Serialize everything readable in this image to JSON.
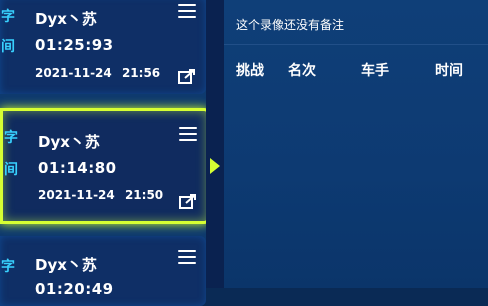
{
  "records": [
    {
      "side_label": "字",
      "side_label2": "间",
      "name": "Dyx丶苏",
      "time": "01:25:93",
      "date": "2021-11-24",
      "clock": "21:56"
    },
    {
      "side_label": "字",
      "side_label2": "间",
      "name": "Dyx丶苏",
      "time": "01:14:80",
      "date": "2021-11-24",
      "clock": "21:50"
    },
    {
      "side_label": "字",
      "side_label2": "",
      "name": "Dyx丶苏",
      "time": "01:20:49",
      "date": "",
      "clock": ""
    }
  ],
  "note_text": "这个录像还没有备注",
  "table_headers": [
    "挑战",
    "名次",
    "车手",
    "时间"
  ],
  "colors": {
    "accent": "#d6ff33",
    "label": "#38d1ff",
    "panel": "#0f3f78"
  }
}
